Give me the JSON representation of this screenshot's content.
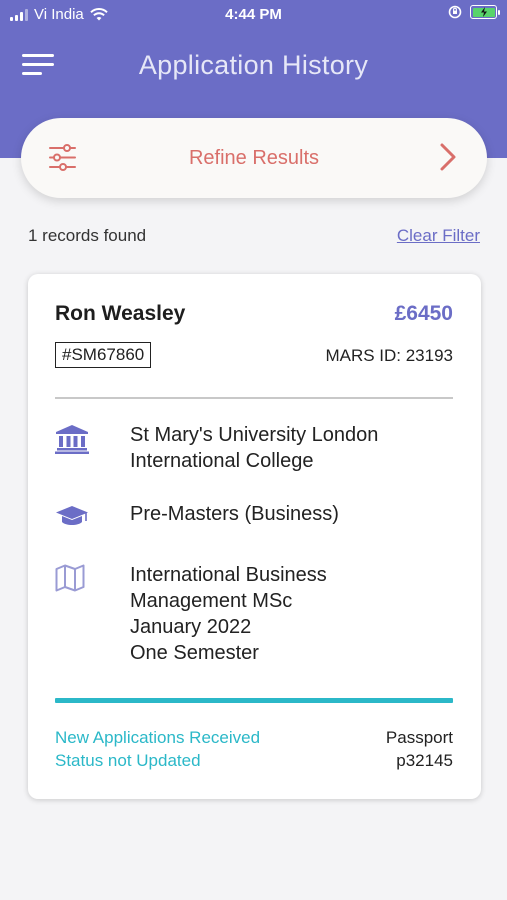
{
  "status_bar": {
    "carrier": "Vi India",
    "time": "4:44 PM"
  },
  "app_bar": {
    "title": "Application History",
    "menu_icon": "hamburger-menu-icon"
  },
  "refine": {
    "label": "Refine Results",
    "icon": "sliders-icon",
    "chevron": "chevron-right-icon"
  },
  "results": {
    "count_text": "1 records found",
    "clear_filter": "Clear Filter"
  },
  "colors": {
    "primary": "#6b6dc6",
    "accent_red": "#d96f6a",
    "status_teal": "#2bb8c8"
  },
  "card": {
    "name": "Ron Weasley",
    "amount": "£6450",
    "reference": "#SM67860",
    "mars_id": "MARS ID: 23193",
    "institution": {
      "icon": "university-building-icon",
      "lines": [
        "St Mary's University London",
        "International College"
      ]
    },
    "level": {
      "icon": "graduation-cap-icon",
      "text": "Pre-Masters  (Business)"
    },
    "course": {
      "icon": "map-icon",
      "lines": [
        "International Business",
        "Management MSc",
        "January 2022",
        "One Semester"
      ]
    },
    "status_lines": [
      "New Applications Received",
      "Status not Updated"
    ],
    "passport_label": "Passport",
    "passport_number": "p32145"
  }
}
